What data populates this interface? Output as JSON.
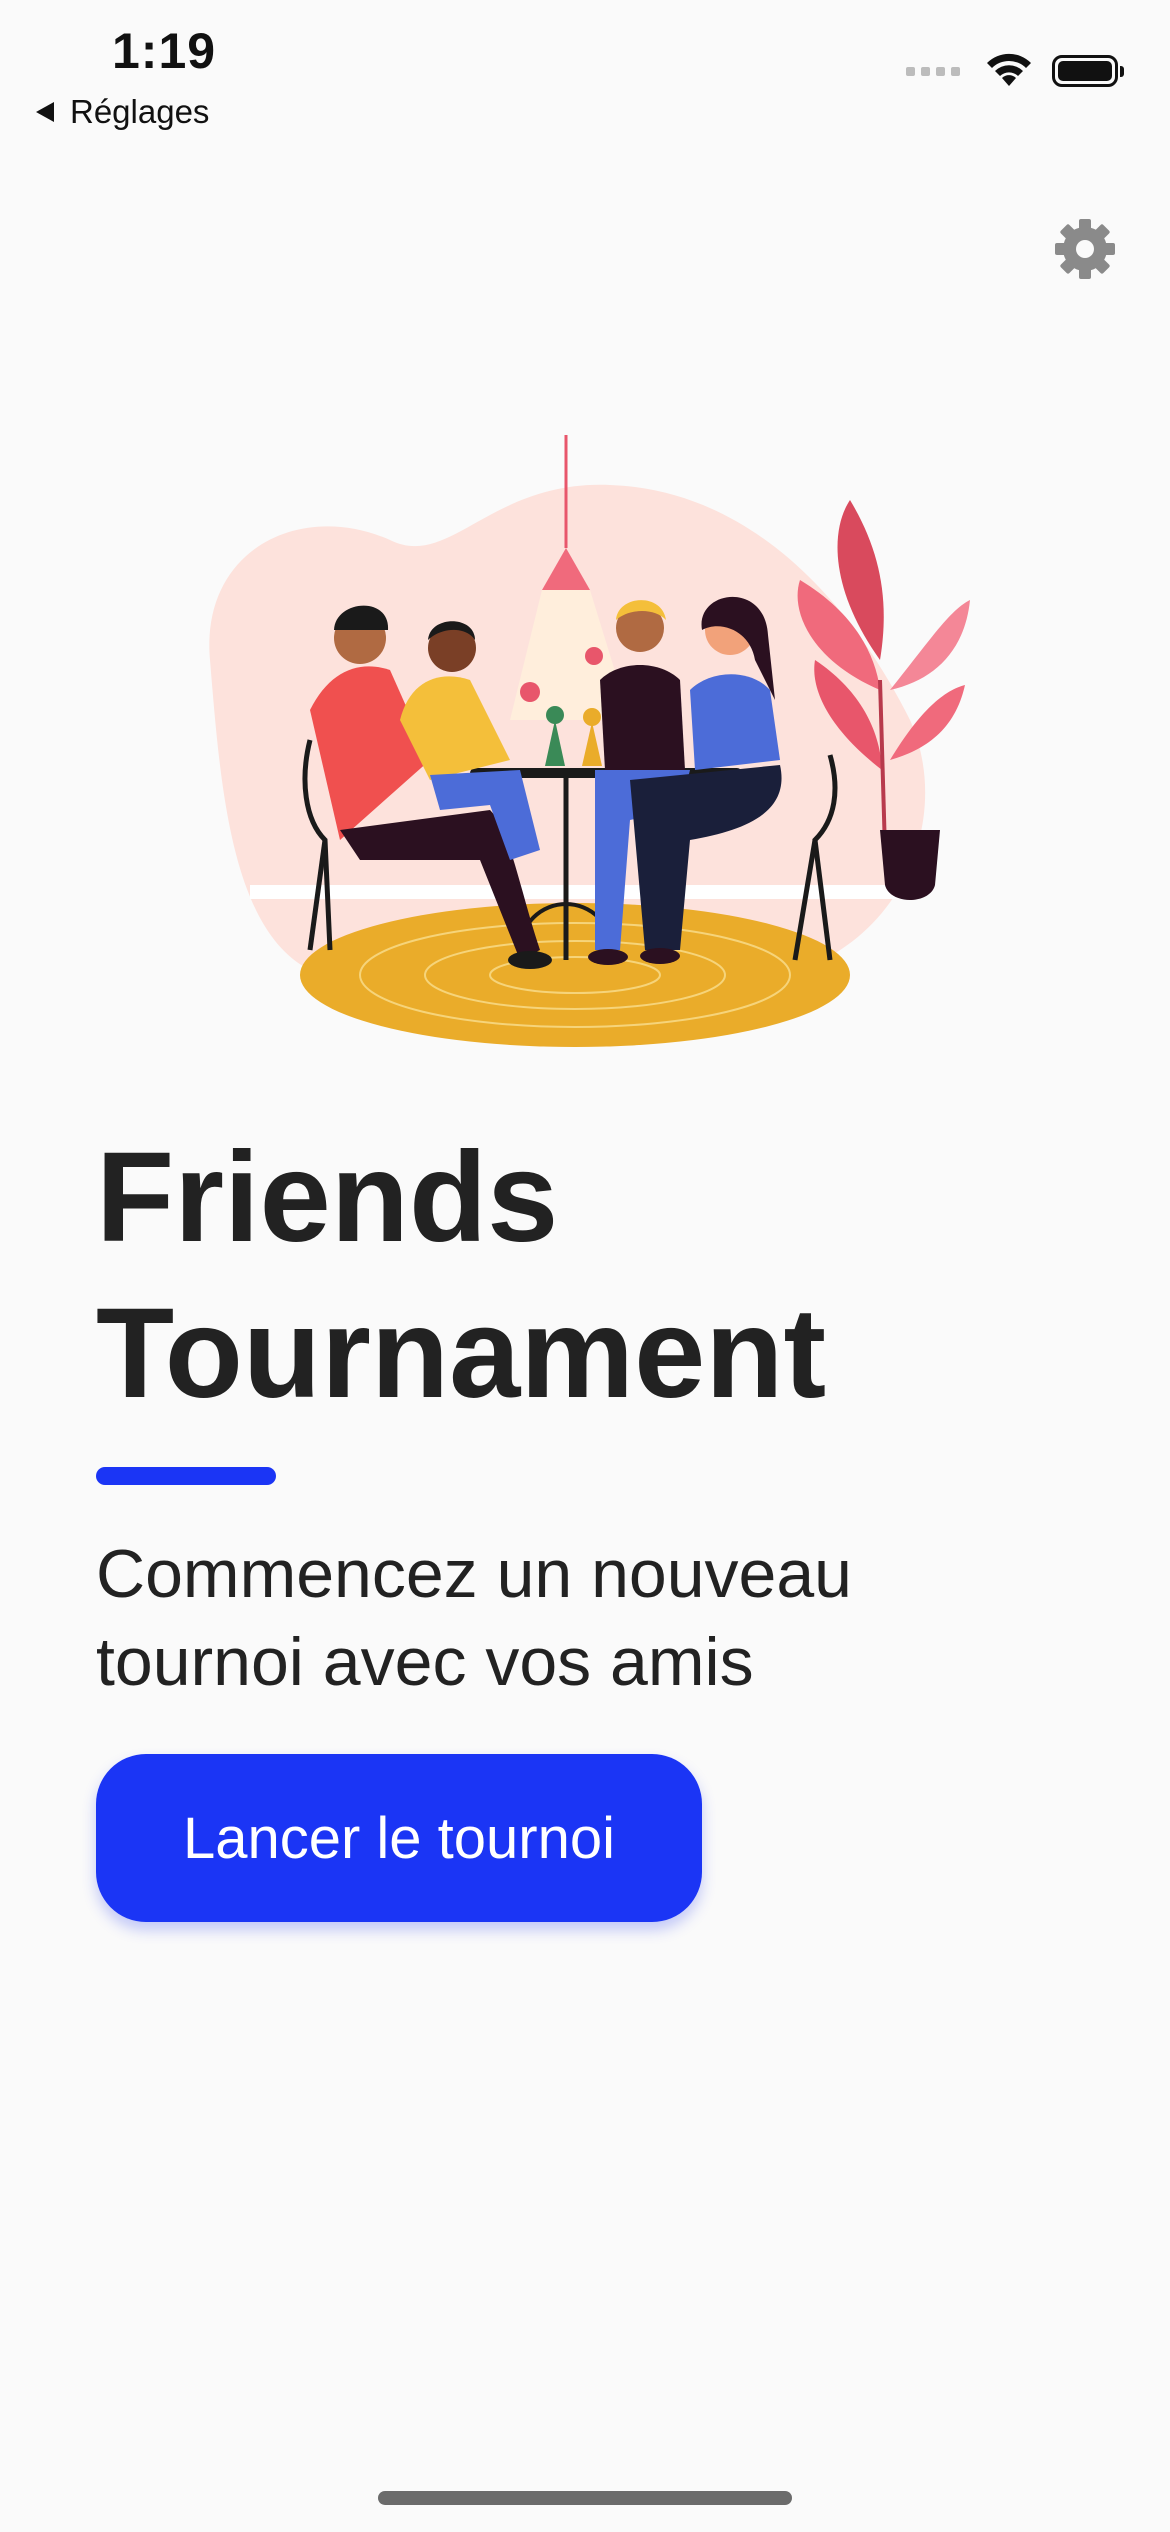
{
  "status_bar": {
    "time": "1:19",
    "back_label": "Réglages"
  },
  "icons": {
    "settings": "gear-icon",
    "back": "back-arrow-icon",
    "wifi": "wifi-icon",
    "battery": "battery-icon"
  },
  "hero": {
    "title_line1": "Friends",
    "title_line2": "Tournament",
    "subtitle_line1": "Commencez un nouveau",
    "subtitle_line2": "tournoi avec vos amis",
    "button_label": "Lancer le tournoi"
  },
  "colors": {
    "accent": "#1b35f5",
    "background": "#fafafa",
    "text": "#222222",
    "gear": "#8a8a8a"
  }
}
